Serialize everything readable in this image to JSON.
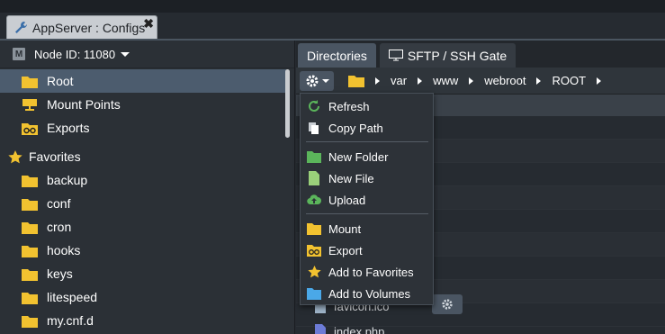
{
  "window": {
    "tab_title": "AppServer : Configs",
    "close_glyph": "✖"
  },
  "left": {
    "node_label": "Node ID: 11080",
    "node_icon_letter": "M",
    "tree": [
      {
        "label": "Root",
        "icon": "folder-icon",
        "selected": true
      },
      {
        "label": "Mount Points",
        "icon": "mount-icon"
      },
      {
        "label": "Exports",
        "icon": "export-icon"
      },
      {
        "label": "Favorites",
        "icon": "star-icon"
      },
      {
        "label": "backup",
        "icon": "folder-icon"
      },
      {
        "label": "conf",
        "icon": "folder-icon"
      },
      {
        "label": "cron",
        "icon": "folder-icon"
      },
      {
        "label": "hooks",
        "icon": "folder-icon"
      },
      {
        "label": "keys",
        "icon": "folder-icon"
      },
      {
        "label": "litespeed",
        "icon": "folder-icon"
      },
      {
        "label": "my.cnf.d",
        "icon": "folder-icon"
      }
    ]
  },
  "right": {
    "tabs": [
      {
        "label": "Directories",
        "active": true
      },
      {
        "label": "SFTP / SSH Gate",
        "active": false
      }
    ],
    "breadcrumb": [
      "var",
      "www",
      "webroot",
      "ROOT"
    ],
    "behind_file": "favicon.ico",
    "behind_file2": "index.php"
  },
  "menu": {
    "items": [
      {
        "label": "Refresh",
        "icon": "refresh-icon"
      },
      {
        "label": "Copy Path",
        "icon": "copy-icon"
      },
      {
        "label": "New Folder",
        "icon": "new-folder-icon"
      },
      {
        "label": "New File",
        "icon": "new-file-icon"
      },
      {
        "label": "Upload",
        "icon": "upload-icon"
      },
      {
        "label": "Mount",
        "icon": "mount-icon"
      },
      {
        "label": "Export",
        "icon": "export-icon"
      },
      {
        "label": "Add to Favorites",
        "icon": "star-icon"
      },
      {
        "label": "Add to Volumes",
        "icon": "volume-folder-icon"
      }
    ]
  },
  "colors": {
    "folder": "#f2c230",
    "green": "#5bb55b",
    "selected_row": "#4c5c6e",
    "accent_tab": "#4a5562"
  }
}
